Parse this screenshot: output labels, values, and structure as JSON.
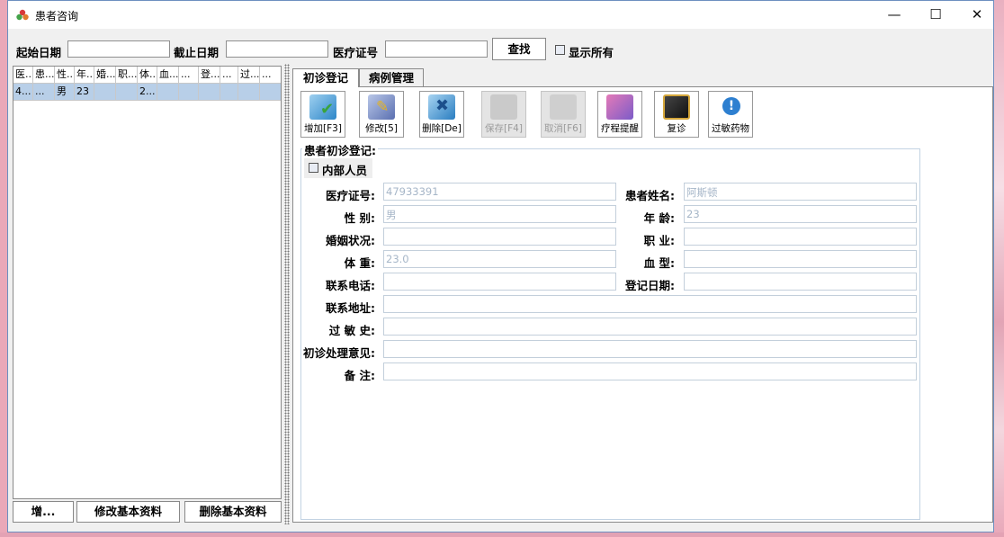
{
  "window": {
    "title": "患者咨询",
    "min_symbol": "—",
    "max_symbol": "☐",
    "close_symbol": "✕"
  },
  "search": {
    "start_label": "起始日期",
    "start_value": "",
    "end_label": "截止日期",
    "end_value": "",
    "card_label": "医疗证号",
    "card_value": "",
    "find_label": "查找",
    "show_all_label": "显示所有"
  },
  "table": {
    "headers": [
      "医...",
      "患...",
      "性...",
      "年...",
      "婚...",
      "职...",
      "体...",
      "血...",
      "...",
      "登...",
      "...",
      "过...",
      "..."
    ],
    "rows": [
      [
        "4...",
        "...",
        "男",
        "23",
        "",
        "",
        "2...",
        "",
        "",
        "",
        "",
        "",
        ""
      ]
    ]
  },
  "left_buttons": {
    "add": "增...",
    "edit": "修改基本资料",
    "delete": "删除基本资料"
  },
  "tabs": [
    "初诊登记",
    "病例管理"
  ],
  "toolbar": {
    "add": "增加[F3]",
    "edit": "修改[5]",
    "delete": "删除[De]",
    "save": "保存[F4]",
    "cancel": "取消[F6]",
    "remind": "疗程提醒",
    "revisit": "复诊",
    "allergy": "过敏药物"
  },
  "form": {
    "group_title": "患者初诊登记:",
    "internal_label": "内部人员",
    "card_no_label": "医疗证号:",
    "card_no_value": "47933391",
    "name_label": "患者姓名:",
    "name_value": "阿斯顿",
    "gender_label": "性  别:",
    "gender_value": "男",
    "age_label": "年  龄:",
    "age_value": "23",
    "marital_label": "婚姻状况:",
    "marital_value": "",
    "job_label": "职  业:",
    "job_value": "",
    "weight_label": "体  重:",
    "weight_value": "23.0",
    "blood_label": "血  型:",
    "blood_value": "",
    "phone_label": "联系电话:",
    "phone_value": "",
    "reg_date_label": "登记日期:",
    "reg_date_value": "",
    "address_label": "联系地址:",
    "address_value": "",
    "allergy_label": "过 敏 史:",
    "allergy_value": "",
    "opinion_label": "初诊处理意见:",
    "opinion_value": "",
    "remark_label": "备  注:",
    "remark_value": ""
  }
}
